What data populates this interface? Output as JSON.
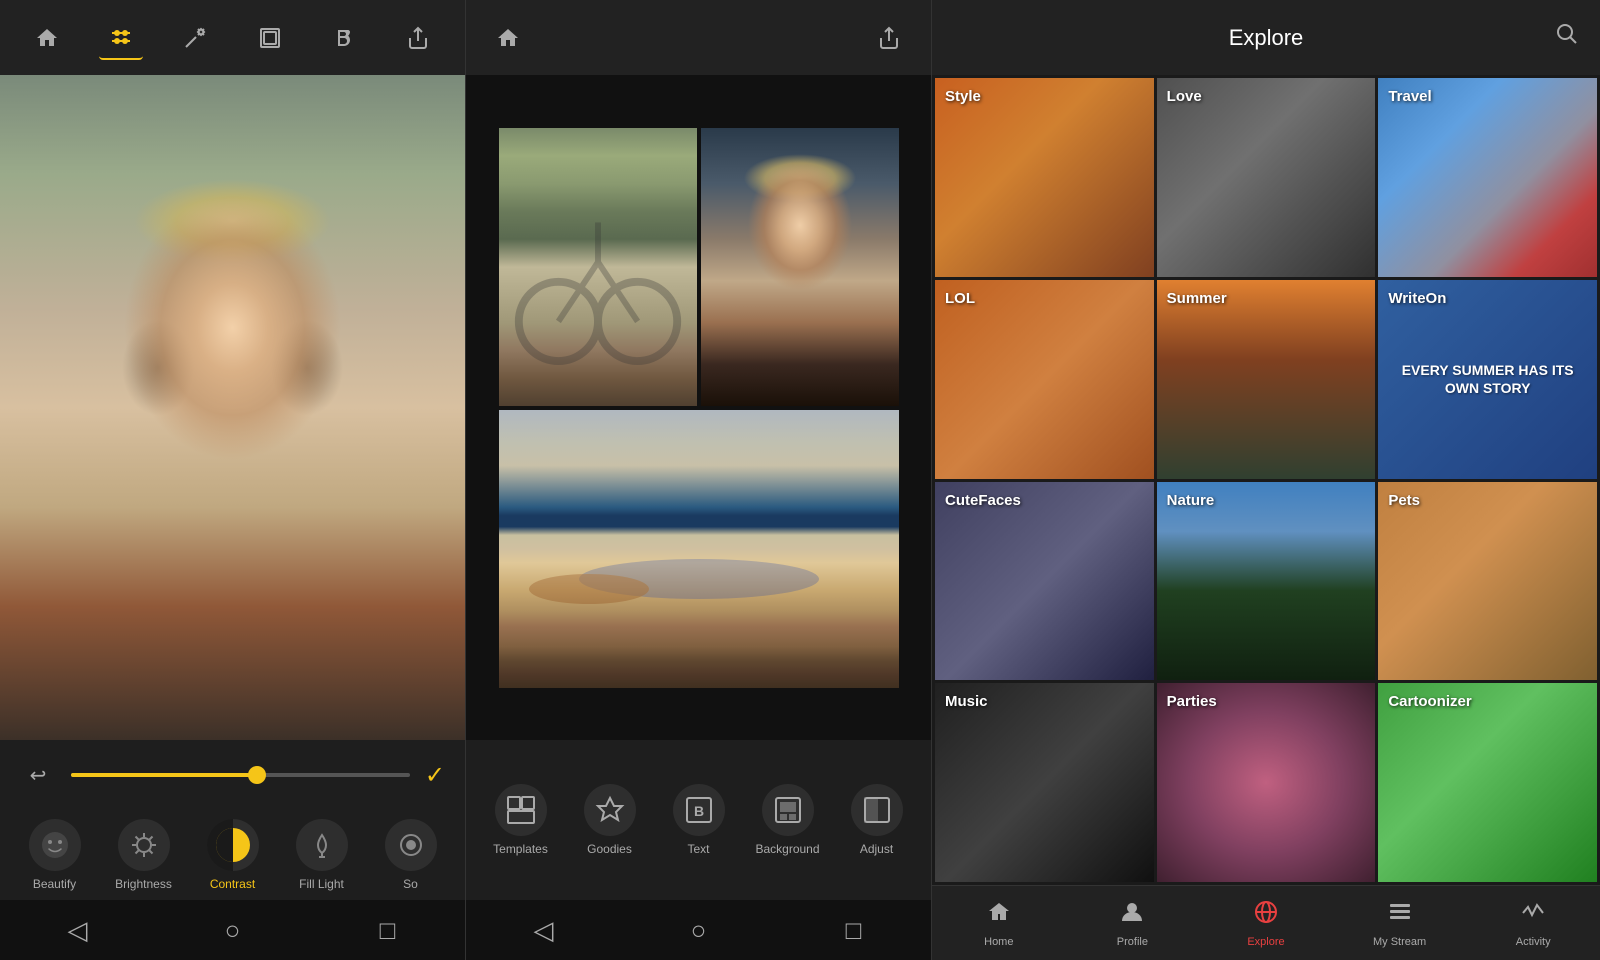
{
  "panel1": {
    "toolbar": {
      "home_label": "⌂",
      "sliders_label": "⊞",
      "wand_label": "✦",
      "frame_label": "▢",
      "bold_label": "B",
      "share_label": "↗"
    },
    "tools": [
      {
        "id": "beautify",
        "label": "Beautify",
        "icon": "☺",
        "active": false
      },
      {
        "id": "brightness",
        "label": "Brightness",
        "icon": "☀",
        "active": false
      },
      {
        "id": "contrast",
        "label": "Contrast",
        "icon": "◑",
        "active": true
      },
      {
        "id": "fill-light",
        "label": "Fill Light",
        "icon": "☛",
        "active": false
      },
      {
        "id": "so",
        "label": "So",
        "icon": "◉",
        "active": false
      }
    ],
    "slider": {
      "value": 55
    },
    "nav": {
      "back": "◁",
      "home": "○",
      "recents": "□"
    }
  },
  "panel2": {
    "tools": [
      {
        "id": "templates",
        "label": "Templates",
        "icon": "⊟"
      },
      {
        "id": "goodies",
        "label": "Goodies",
        "icon": "◈"
      },
      {
        "id": "text",
        "label": "Text",
        "icon": "B"
      },
      {
        "id": "background",
        "label": "Background",
        "icon": "▣"
      },
      {
        "id": "adjust",
        "label": "Adjust",
        "icon": "◧"
      }
    ],
    "nav": {
      "back": "◁",
      "home": "○",
      "recents": "□"
    }
  },
  "panel3": {
    "header": {
      "title": "Explore"
    },
    "grid": [
      {
        "id": "style",
        "label": "Style",
        "class": "cell-style"
      },
      {
        "id": "love",
        "label": "Love",
        "class": "cell-love"
      },
      {
        "id": "travel",
        "label": "Travel",
        "class": "cell-travel"
      },
      {
        "id": "lol",
        "label": "LOL",
        "class": "cell-lol"
      },
      {
        "id": "summer",
        "label": "Summer",
        "class": "cell-summer"
      },
      {
        "id": "writeon",
        "label": "WriteOn",
        "class": "cell-writeon",
        "subtext": "EVERY SUMMER HAS ITS OWN STORY"
      },
      {
        "id": "cutefaces",
        "label": "CuteFaces",
        "class": "cell-cutefaces"
      },
      {
        "id": "nature",
        "label": "Nature",
        "class": "cell-nature"
      },
      {
        "id": "pets",
        "label": "Pets",
        "class": "cell-pets"
      },
      {
        "id": "music",
        "label": "Music",
        "class": "cell-music"
      },
      {
        "id": "parties",
        "label": "Parties",
        "class": "cell-parties"
      },
      {
        "id": "cartoonizer",
        "label": "Cartoonizer",
        "class": "cell-cartoonizer"
      }
    ],
    "nav": [
      {
        "id": "home",
        "label": "Home",
        "icon": "⌂",
        "active": false
      },
      {
        "id": "profile",
        "label": "Profile",
        "icon": "👤",
        "active": false
      },
      {
        "id": "explore",
        "label": "Explore",
        "icon": "🌐",
        "active": true
      },
      {
        "id": "mystream",
        "label": "My Stream",
        "icon": "≡",
        "active": false
      },
      {
        "id": "activity",
        "label": "Activity",
        "icon": "⚡",
        "active": false
      }
    ]
  }
}
